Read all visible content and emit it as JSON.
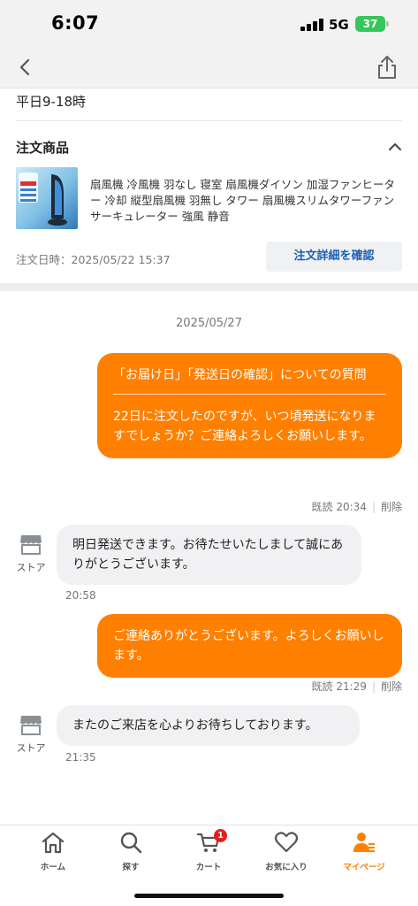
{
  "status_bar": {
    "time": "6:07",
    "network": "5G",
    "battery": "37"
  },
  "order_panel": {
    "hours": "平日9-18時",
    "section_title": "注文商品",
    "product_name": "扇風機 冷風機 羽なし 寝室 扇風機ダイソン 加湿ファンヒーター 冷却 縦型扇風機 羽無し タワー 扇風機スリムタワーファン サーキュレーター 強風 静音",
    "order_date": "注文日時：2025/05/22 15:37",
    "detail_button": "注文詳細を確認"
  },
  "chat": {
    "date_separator": "2025/05/27",
    "messages": [
      {
        "heading": "「お届け日」「発送日の確認」についての質問",
        "body": "22日に注文したのですが、いつ頃発送になりますでしょうか？ご連絡よろしくお願いします。",
        "read_status": "既読 20:34",
        "delete_label": "削除"
      },
      {
        "store_label": "ストア",
        "body": "明日発送できます。お待たせいたしまして誠にありがとうございます。",
        "time": "20:58"
      },
      {
        "body": "ご連絡ありがとうございます。よろしくお願いします。",
        "read_status": "既読 21:29",
        "delete_label": "削除"
      },
      {
        "store_label": "ストア",
        "body": "またのご来店を心よりお待ちしております。",
        "time": "21:35"
      }
    ]
  },
  "bottom_nav": {
    "items": [
      {
        "label": "ホーム",
        "icon": "home-icon"
      },
      {
        "label": "探す",
        "icon": "search-icon"
      },
      {
        "label": "カート",
        "icon": "cart-icon",
        "badge": "1"
      },
      {
        "label": "お気に入り",
        "icon": "heart-icon"
      },
      {
        "label": "マイページ",
        "icon": "user-icon",
        "active": true
      }
    ]
  },
  "colors": {
    "accent": "#ff7f00",
    "link": "#1a5fb4",
    "badge": "#e02020",
    "battery": "#34c759"
  }
}
